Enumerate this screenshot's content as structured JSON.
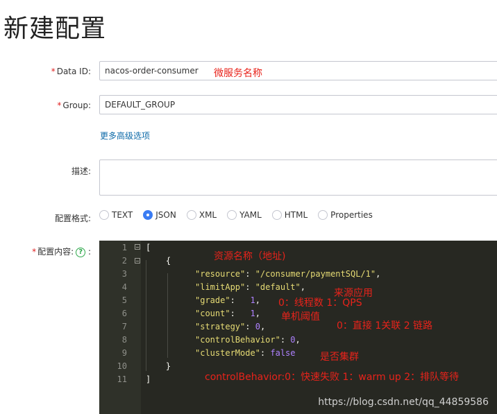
{
  "page": {
    "title": "新建配置"
  },
  "form": {
    "data_id": {
      "label": "Data ID:",
      "value": "nacos-order-consumer",
      "annotation": "微服务名称"
    },
    "group": {
      "label": "Group:",
      "value": "DEFAULT_GROUP"
    },
    "advanced_link": "更多高级选项",
    "description": {
      "label": "描述:"
    },
    "format": {
      "label": "配置格式:",
      "options": [
        "TEXT",
        "JSON",
        "XML",
        "YAML",
        "HTML",
        "Properties"
      ],
      "selected": "JSON"
    },
    "content": {
      "label": "配置内容:",
      "help": "?",
      "colon": ":"
    }
  },
  "editor": {
    "line_numbers": [
      "1",
      "2",
      "3",
      "4",
      "5",
      "6",
      "7",
      "8",
      "9",
      "10",
      "11"
    ],
    "lines": [
      {
        "p1": "["
      },
      {
        "p1": "    {"
      },
      {
        "k": "\"resource\"",
        "s": ": ",
        "v": "\"/consumer/paymentSQL/1\"",
        "e": ","
      },
      {
        "k": "\"limitApp\"",
        "s": ": ",
        "v": "\"default\"",
        "e": ","
      },
      {
        "k": "\"grade\"",
        "s": ":   ",
        "v": "1",
        "e": ","
      },
      {
        "k": "\"count\"",
        "s": ":   ",
        "v": "1",
        "e": ","
      },
      {
        "k": "\"strategy\"",
        "s": ": ",
        "v": "0",
        "e": ","
      },
      {
        "k": "\"controlBehavior\"",
        "s": ": ",
        "v": "0",
        "e": ","
      },
      {
        "k": "\"clusterMode\"",
        "s": ": ",
        "v": "false",
        "e": ""
      },
      {
        "p1": "    }"
      },
      {
        "p1": "]"
      }
    ],
    "annotations": {
      "resource": "资源名称（地址)",
      "limitApp": "来源应用",
      "grade": "0：线程数 1：QPS",
      "count": "单机阈值",
      "strategy": "0：直接 1关联 2 链路",
      "clusterMode": "是否集群",
      "controlBehavior": "controlBehavior:0：快速失败 1：warm up 2：排队等待"
    }
  },
  "watermark": "https://blog.csdn.net/qq_44859586",
  "colors": {
    "accent": "#3a7cf3",
    "annotation": "#e8231b",
    "link": "#0d6aa8",
    "editor_bg": "#272822"
  }
}
